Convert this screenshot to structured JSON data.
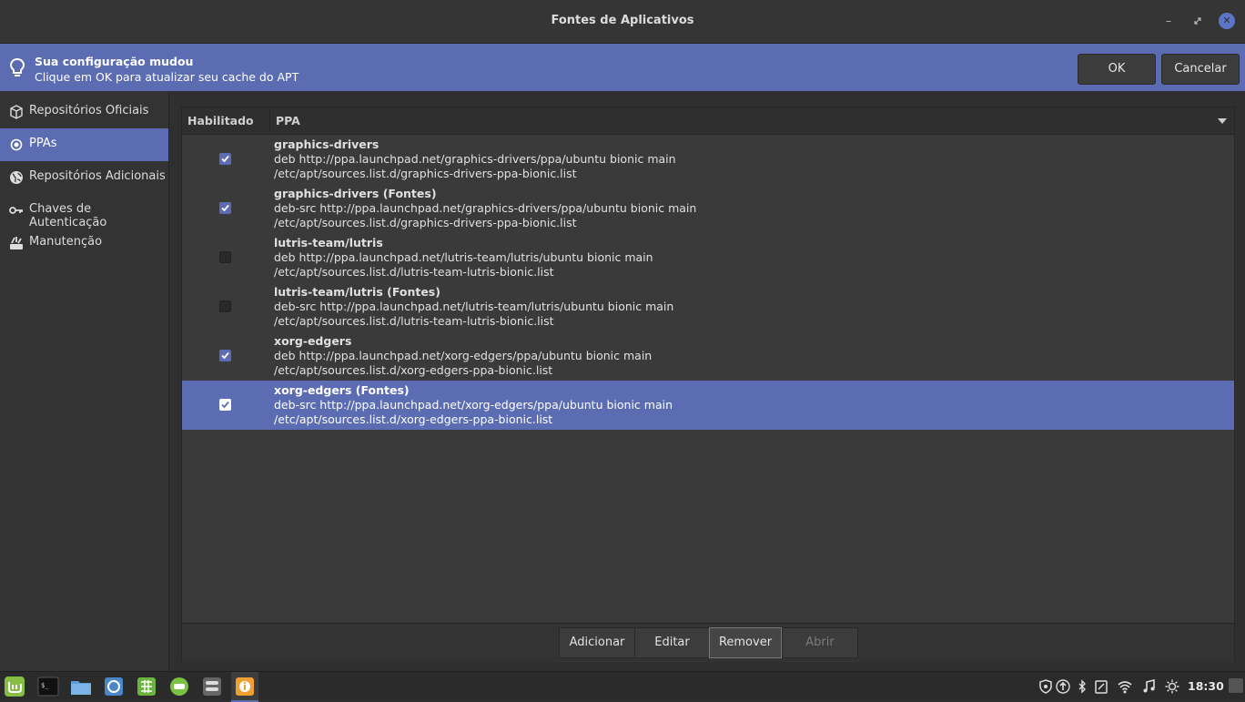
{
  "window": {
    "title": "Fontes de Aplicativos"
  },
  "infobar": {
    "title": "Sua configuração mudou",
    "message": "Clique em OK para atualizar seu cache do APT",
    "ok_label": "OK",
    "cancel_label": "Cancelar"
  },
  "sidebar": {
    "items": [
      {
        "label": "Repositórios Oficiais",
        "icon": "package-icon"
      },
      {
        "label": "PPAs",
        "icon": "ppa-icon",
        "active": true
      },
      {
        "label": "Repositórios Adicionais",
        "icon": "globe-icon"
      },
      {
        "label": "Chaves de Autenticação",
        "icon": "key-icon"
      },
      {
        "label": "Manutenção",
        "icon": "maintenance-icon"
      }
    ]
  },
  "table": {
    "col_enabled": "Habilitado",
    "col_ppa": "PPA",
    "rows": [
      {
        "name": "graphics-drivers",
        "line": "deb http://ppa.launchpad.net/graphics-drivers/ppa/ubuntu bionic main",
        "file": "/etc/apt/sources.list.d/graphics-drivers-ppa-bionic.list",
        "enabled": true
      },
      {
        "name": "graphics-drivers (Fontes)",
        "line": "deb-src http://ppa.launchpad.net/graphics-drivers/ppa/ubuntu bionic main",
        "file": "/etc/apt/sources.list.d/graphics-drivers-ppa-bionic.list",
        "enabled": true
      },
      {
        "name": "lutris-team/lutris",
        "line": "deb http://ppa.launchpad.net/lutris-team/lutris/ubuntu bionic main",
        "file": "/etc/apt/sources.list.d/lutris-team-lutris-bionic.list",
        "enabled": false
      },
      {
        "name": "lutris-team/lutris (Fontes)",
        "line": "deb-src http://ppa.launchpad.net/lutris-team/lutris/ubuntu bionic main",
        "file": "/etc/apt/sources.list.d/lutris-team-lutris-bionic.list",
        "enabled": false
      },
      {
        "name": "xorg-edgers",
        "line": "deb http://ppa.launchpad.net/xorg-edgers/ppa/ubuntu bionic main",
        "file": "/etc/apt/sources.list.d/xorg-edgers-ppa-bionic.list",
        "enabled": true
      },
      {
        "name": "xorg-edgers (Fontes)",
        "line": "deb-src http://ppa.launchpad.net/xorg-edgers/ppa/ubuntu bionic main",
        "file": "/etc/apt/sources.list.d/xorg-edgers-ppa-bionic.list",
        "enabled": true,
        "selected": true
      }
    ]
  },
  "actions": {
    "add": "Adicionar",
    "edit": "Editar",
    "remove": "Remover",
    "open": "Abrir"
  },
  "taskbar": {
    "clock": "18:30",
    "apps": [
      "mint-menu-icon",
      "terminal-icon",
      "files-icon",
      "browser-icon",
      "spreadsheet-icon",
      "updater-icon",
      "settings-icon",
      "software-sources-icon"
    ],
    "tray": [
      "shield-icon",
      "update-arrow-icon",
      "bluetooth-icon",
      "clipboard-icon",
      "wifi-icon",
      "music-icon",
      "brightness-icon"
    ]
  },
  "colors": {
    "accent": "#5b6cb3",
    "background": "#2f2f2f"
  }
}
